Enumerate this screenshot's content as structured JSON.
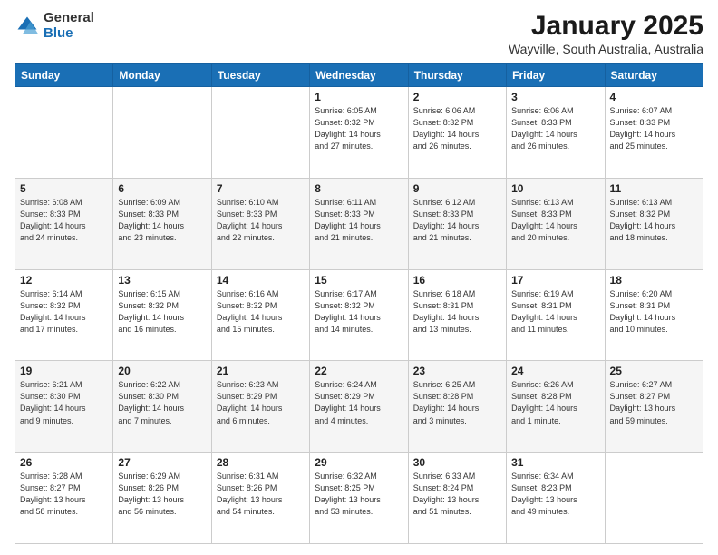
{
  "header": {
    "logo_general": "General",
    "logo_blue": "Blue",
    "title": "January 2025",
    "location": "Wayville, South Australia, Australia"
  },
  "days_of_week": [
    "Sunday",
    "Monday",
    "Tuesday",
    "Wednesday",
    "Thursday",
    "Friday",
    "Saturday"
  ],
  "weeks": [
    [
      {
        "day": "",
        "info": ""
      },
      {
        "day": "",
        "info": ""
      },
      {
        "day": "",
        "info": ""
      },
      {
        "day": "1",
        "info": "Sunrise: 6:05 AM\nSunset: 8:32 PM\nDaylight: 14 hours\nand 27 minutes."
      },
      {
        "day": "2",
        "info": "Sunrise: 6:06 AM\nSunset: 8:32 PM\nDaylight: 14 hours\nand 26 minutes."
      },
      {
        "day": "3",
        "info": "Sunrise: 6:06 AM\nSunset: 8:33 PM\nDaylight: 14 hours\nand 26 minutes."
      },
      {
        "day": "4",
        "info": "Sunrise: 6:07 AM\nSunset: 8:33 PM\nDaylight: 14 hours\nand 25 minutes."
      }
    ],
    [
      {
        "day": "5",
        "info": "Sunrise: 6:08 AM\nSunset: 8:33 PM\nDaylight: 14 hours\nand 24 minutes."
      },
      {
        "day": "6",
        "info": "Sunrise: 6:09 AM\nSunset: 8:33 PM\nDaylight: 14 hours\nand 23 minutes."
      },
      {
        "day": "7",
        "info": "Sunrise: 6:10 AM\nSunset: 8:33 PM\nDaylight: 14 hours\nand 22 minutes."
      },
      {
        "day": "8",
        "info": "Sunrise: 6:11 AM\nSunset: 8:33 PM\nDaylight: 14 hours\nand 21 minutes."
      },
      {
        "day": "9",
        "info": "Sunrise: 6:12 AM\nSunset: 8:33 PM\nDaylight: 14 hours\nand 21 minutes."
      },
      {
        "day": "10",
        "info": "Sunrise: 6:13 AM\nSunset: 8:33 PM\nDaylight: 14 hours\nand 20 minutes."
      },
      {
        "day": "11",
        "info": "Sunrise: 6:13 AM\nSunset: 8:32 PM\nDaylight: 14 hours\nand 18 minutes."
      }
    ],
    [
      {
        "day": "12",
        "info": "Sunrise: 6:14 AM\nSunset: 8:32 PM\nDaylight: 14 hours\nand 17 minutes."
      },
      {
        "day": "13",
        "info": "Sunrise: 6:15 AM\nSunset: 8:32 PM\nDaylight: 14 hours\nand 16 minutes."
      },
      {
        "day": "14",
        "info": "Sunrise: 6:16 AM\nSunset: 8:32 PM\nDaylight: 14 hours\nand 15 minutes."
      },
      {
        "day": "15",
        "info": "Sunrise: 6:17 AM\nSunset: 8:32 PM\nDaylight: 14 hours\nand 14 minutes."
      },
      {
        "day": "16",
        "info": "Sunrise: 6:18 AM\nSunset: 8:31 PM\nDaylight: 14 hours\nand 13 minutes."
      },
      {
        "day": "17",
        "info": "Sunrise: 6:19 AM\nSunset: 8:31 PM\nDaylight: 14 hours\nand 11 minutes."
      },
      {
        "day": "18",
        "info": "Sunrise: 6:20 AM\nSunset: 8:31 PM\nDaylight: 14 hours\nand 10 minutes."
      }
    ],
    [
      {
        "day": "19",
        "info": "Sunrise: 6:21 AM\nSunset: 8:30 PM\nDaylight: 14 hours\nand 9 minutes."
      },
      {
        "day": "20",
        "info": "Sunrise: 6:22 AM\nSunset: 8:30 PM\nDaylight: 14 hours\nand 7 minutes."
      },
      {
        "day": "21",
        "info": "Sunrise: 6:23 AM\nSunset: 8:29 PM\nDaylight: 14 hours\nand 6 minutes."
      },
      {
        "day": "22",
        "info": "Sunrise: 6:24 AM\nSunset: 8:29 PM\nDaylight: 14 hours\nand 4 minutes."
      },
      {
        "day": "23",
        "info": "Sunrise: 6:25 AM\nSunset: 8:28 PM\nDaylight: 14 hours\nand 3 minutes."
      },
      {
        "day": "24",
        "info": "Sunrise: 6:26 AM\nSunset: 8:28 PM\nDaylight: 14 hours\nand 1 minute."
      },
      {
        "day": "25",
        "info": "Sunrise: 6:27 AM\nSunset: 8:27 PM\nDaylight: 13 hours\nand 59 minutes."
      }
    ],
    [
      {
        "day": "26",
        "info": "Sunrise: 6:28 AM\nSunset: 8:27 PM\nDaylight: 13 hours\nand 58 minutes."
      },
      {
        "day": "27",
        "info": "Sunrise: 6:29 AM\nSunset: 8:26 PM\nDaylight: 13 hours\nand 56 minutes."
      },
      {
        "day": "28",
        "info": "Sunrise: 6:31 AM\nSunset: 8:26 PM\nDaylight: 13 hours\nand 54 minutes."
      },
      {
        "day": "29",
        "info": "Sunrise: 6:32 AM\nSunset: 8:25 PM\nDaylight: 13 hours\nand 53 minutes."
      },
      {
        "day": "30",
        "info": "Sunrise: 6:33 AM\nSunset: 8:24 PM\nDaylight: 13 hours\nand 51 minutes."
      },
      {
        "day": "31",
        "info": "Sunrise: 6:34 AM\nSunset: 8:23 PM\nDaylight: 13 hours\nand 49 minutes."
      },
      {
        "day": "",
        "info": ""
      }
    ]
  ]
}
